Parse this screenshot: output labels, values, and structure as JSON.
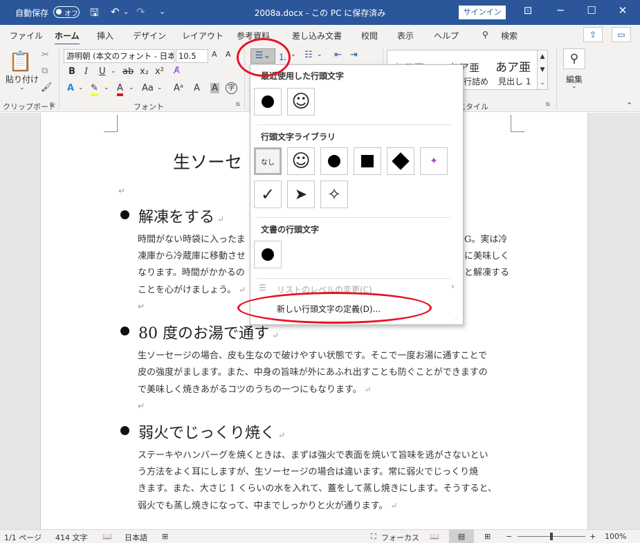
{
  "titlebar": {
    "autosave_label": "自動保存",
    "autosave_state": "オフ",
    "doc_title": "2008a.docx - この PC に保存済み",
    "signin_label": "サインイン"
  },
  "tabs": [
    "ファイル",
    "ホーム",
    "挿入",
    "デザイン",
    "レイアウト",
    "参考資料",
    "差し込み文書",
    "校閲",
    "表示",
    "ヘルプ"
  ],
  "search_label": "検索",
  "ribbon": {
    "paste_label": "貼り付け",
    "clipboard_label": "クリップボード",
    "font_name": "游明朝 (本文のフォント - 日本",
    "font_size": "10.5",
    "font_group_label": "フォント",
    "styles_label": "スタイル",
    "style1": "あア亜",
    "style2": "あア亜",
    "style3": "あア亜",
    "style2_name": "行詰め",
    "style3_name": "見出し 1",
    "edit_label": "編集"
  },
  "document": {
    "title_partial": "生ソーセ",
    "sections": [
      {
        "heading": "解凍をする",
        "lines": [
          "時間がない時袋に入ったま",
          "凍庫から冷蔵庫に移動させ",
          "なります。時間がかかるの",
          "ことを心がけましょう。"
        ],
        "lines_right": [
          "G。実は冷",
          "に美味しく",
          "と解凍する"
        ]
      },
      {
        "heading": "80 度のお湯で通す",
        "lines": [
          "生ソーセージの場合、皮も生なので破けやすい状態です。そこで一度お湯に通すことで",
          "皮の強度がまします。また、中身の旨味が外にあふれ出すことも防ぐことができますの",
          "で美味しく焼きあがるコツのうちの一つにもなります。"
        ]
      },
      {
        "heading": "弱火でじっくり焼く",
        "lines": [
          "ステーキやハンバーグを焼くときは、まずは強火で表面を焼いて旨味を逃がさないとい",
          "う方法をよく耳にしますが、生ソーセージの場合は違います。常に弱火でじっくり焼",
          "きます。また、大さじ 1 くらいの水を入れて、蓋をして蒸し焼きにします。そうすると、",
          "弱火でも蒸し焼きになって、中までしっかりと火が通ります。"
        ]
      }
    ]
  },
  "dropdown": {
    "recent_label": "最近使用した行頭文字",
    "library_label": "行頭文字ライブラリ",
    "none_label": "なし",
    "doc_bullets_label": "文書の行頭文字",
    "change_level_label": "リストのレベルの変更(C)",
    "define_new_label": "新しい行頭文字の定義(D)..."
  },
  "statusbar": {
    "page": "1/1 ページ",
    "words": "414 文字",
    "language": "日本語",
    "focus": "フォーカス",
    "zoom": "100%"
  },
  "colors": {
    "titlebar": "#2b579a",
    "annotation": "#e81123"
  }
}
